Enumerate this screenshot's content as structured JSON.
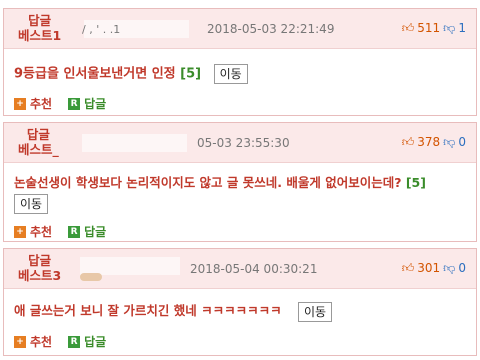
{
  "posts": [
    {
      "badge_top": "답글",
      "badge_bottom": "베스트1",
      "user_tail": "/  ,  '  .  .1",
      "date": "2018-05-03 22:21:49",
      "upvotes": "511",
      "downvotes": "1",
      "text": "9등급을 인서울보낸거면 인정",
      "reply_count": "[5]",
      "move_label": "이동"
    },
    {
      "badge_top": "답글",
      "badge_bottom": "베스트_",
      "user_tail": "",
      "date": "05-03 23:55:30",
      "upvotes": "378",
      "downvotes": "0",
      "text": "논술선생이 학생보다 논리적이지도 않고 글 못쓰네. 배울게 없어보이는데?",
      "reply_count": "[5]",
      "move_label": "이동"
    },
    {
      "badge_top": "답글",
      "badge_bottom": "베스트3",
      "user_tail": "",
      "date": "2018-05-04 00:30:21",
      "upvotes": "301",
      "downvotes": "0",
      "text": "애 글쓰는거 보니 잘 가르치긴 했네 ㅋㅋㅋㅋㅋㅋㅋ",
      "reply_count": "",
      "move_label": "이동"
    }
  ],
  "actions": {
    "recommend_icon": "+",
    "recommend_label": "추천",
    "reply_icon": "R",
    "reply_label": "답글"
  },
  "icons": {
    "thumb_up": "thumbs-up-icon",
    "thumb_down": "thumbs-down-icon"
  },
  "colors": {
    "accent_red": "#c0392b",
    "header_bg": "#fbe9e9",
    "reply_green": "#3a8c2a",
    "upvote_orange": "#d35400",
    "downvote_blue": "#2c6fbf"
  }
}
